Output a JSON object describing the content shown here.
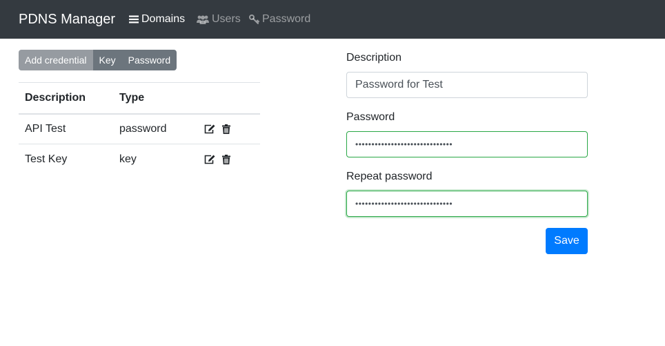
{
  "navbar": {
    "brand": "PDNS Manager",
    "items": [
      {
        "label": "Domains",
        "icon": "list-icon",
        "active": true
      },
      {
        "label": "Users",
        "icon": "users-icon",
        "active": false
      },
      {
        "label": "Password",
        "icon": "key-icon",
        "active": false
      }
    ]
  },
  "credential_tabs": {
    "add_label": "Add credential",
    "key_label": "Key",
    "password_label": "Password"
  },
  "table": {
    "headers": {
      "description": "Description",
      "type": "Type"
    },
    "rows": [
      {
        "description": "API Test",
        "type": "password"
      },
      {
        "description": "Test Key",
        "type": "key"
      }
    ]
  },
  "form": {
    "description_label": "Description",
    "description_value": "Password for Test",
    "password_label": "Password",
    "password_value": "••••••••••••••••••••••••••••••",
    "repeat_label": "Repeat password",
    "repeat_value": "••••••••••••••••••••••••••••••",
    "save_label": "Save"
  },
  "colors": {
    "navbar_bg": "#343a40",
    "primary": "#007bff",
    "valid_green": "#28a745",
    "secondary": "#6c757d"
  }
}
